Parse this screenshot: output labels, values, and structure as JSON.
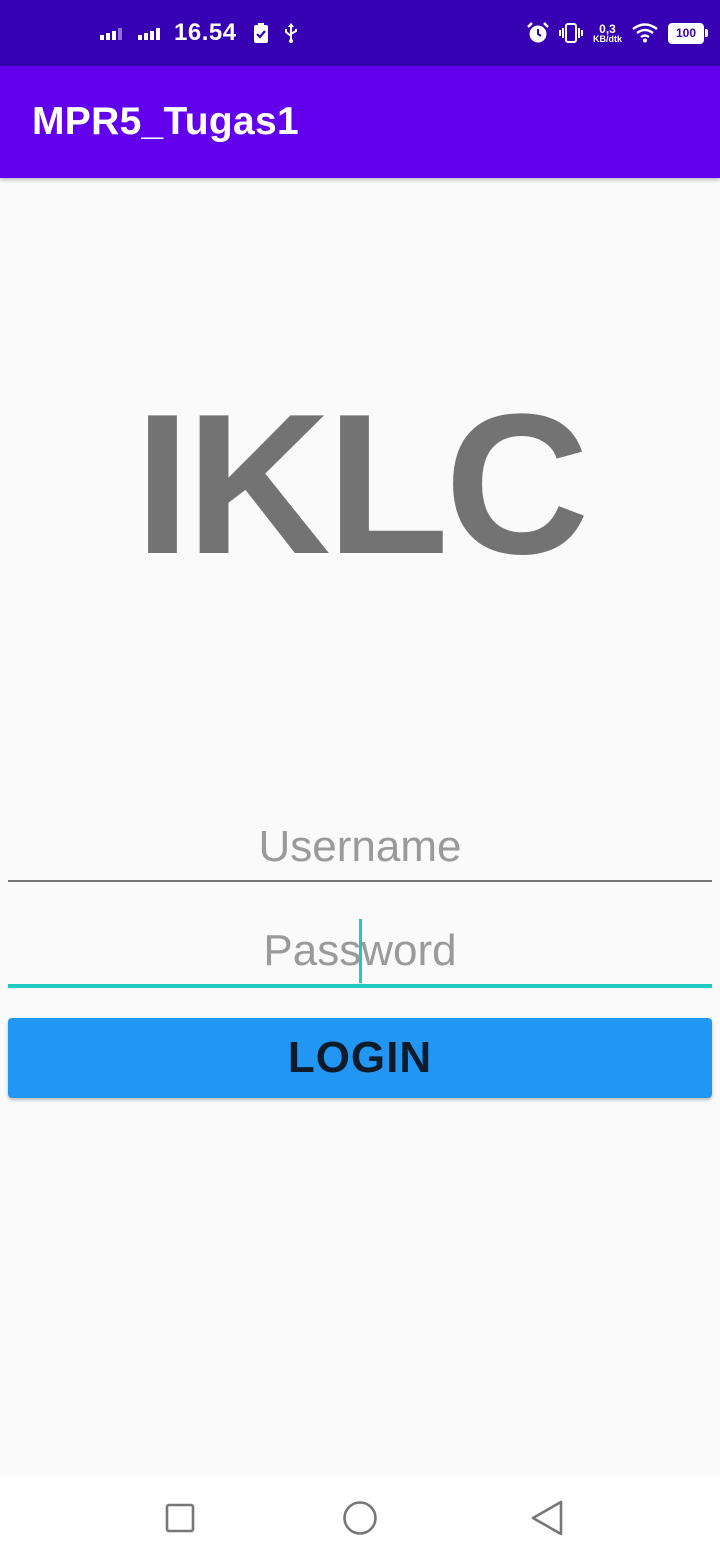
{
  "status_bar": {
    "time": "16.54",
    "net_speed_value": "0,3",
    "net_speed_unit": "KB/dtk",
    "battery_level": "100",
    "icons": [
      "signal-sim1-icon",
      "signal-sim2-icon",
      "battery-saver-icon",
      "usb-icon",
      "alarm-icon",
      "vibrate-icon",
      "wifi-icon",
      "battery-icon"
    ]
  },
  "app_bar": {
    "title": "MPR5_Tugas1"
  },
  "logo": {
    "text": "IKLC"
  },
  "form": {
    "username_placeholder": "Username",
    "password_placeholder": "Password",
    "login_label": "LOGIN"
  },
  "nav_bar": {
    "icons": [
      "recent-apps-icon",
      "home-icon",
      "back-icon"
    ]
  },
  "colors": {
    "status_bar": "#3700b3",
    "app_bar": "#6200ee",
    "focus_accent": "#1fc8c0",
    "login_button": "#2196f3",
    "logo_text": "#737373",
    "background": "#fafafa"
  }
}
